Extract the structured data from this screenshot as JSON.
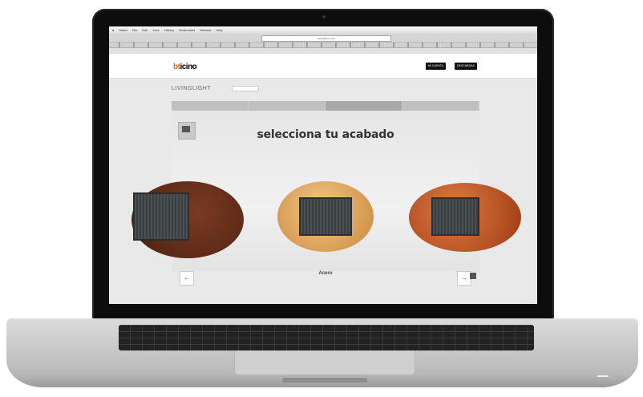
{
  "browser": {
    "menubar": [
      "Safari",
      "File",
      "Edit",
      "View",
      "History",
      "Bookmarks",
      "Window",
      "Help"
    ],
    "url": "www.bticino.com"
  },
  "site": {
    "logo_prefix": "bt",
    "logo_suffix": "icino",
    "header_buttons": [
      "MI CUENTA",
      "DESCARGAS"
    ]
  },
  "configurator": {
    "product": "LIVINGLIGHT",
    "headline": "selecciona tu acabado",
    "prev_arrow": "←",
    "next_arrow": "→",
    "selected_finish": "Acero"
  },
  "colors": {
    "accent": "#e8661d"
  }
}
